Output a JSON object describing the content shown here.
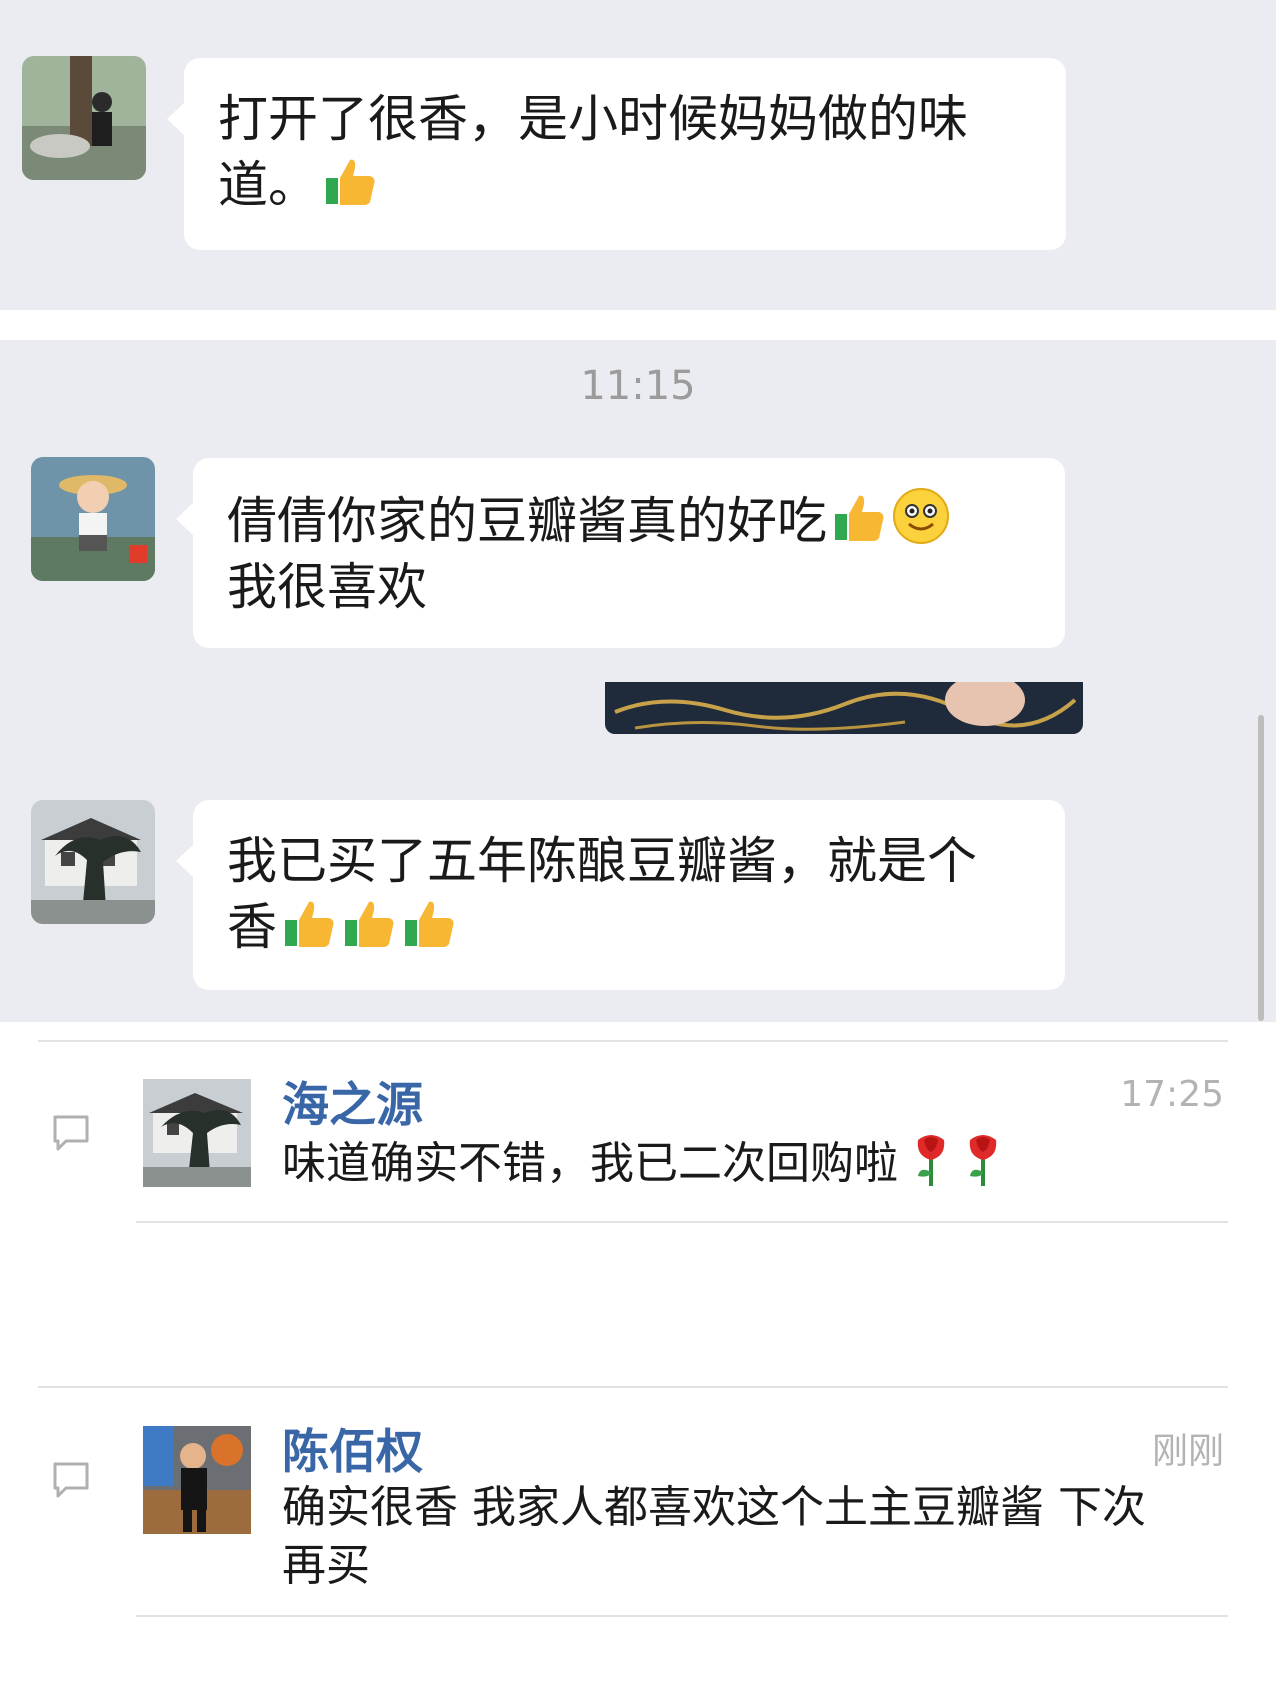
{
  "chat": {
    "messages": [
      {
        "text_line1": "打开了很香，是小时候妈妈做的味",
        "text_line2": "道。",
        "trailing_emoji": [
          "thumbs-up"
        ]
      },
      {
        "text_line1": "倩倩你家的豆瓣酱真的好吃",
        "text_line2": "我很喜欢",
        "trailing_emoji": [
          "thumbs-up",
          "smile"
        ]
      },
      {
        "text_line1": "我已买了五年陈酿豆瓣酱，就是个",
        "text_line2": "香",
        "trailing_emoji": [
          "thumbs-up",
          "thumbs-up",
          "thumbs-up"
        ]
      }
    ],
    "timestamp": "11:15"
  },
  "comments": [
    {
      "name": "海之源",
      "time": "17:25",
      "text": "味道确实不错，我已二次回购啦",
      "emoji": [
        "rose",
        "rose"
      ]
    },
    {
      "name": "陈佰权",
      "time": "刚刚",
      "text_line1": "确实很香 我家人都喜欢这个土主豆瓣酱 下次",
      "text_line2": "再买"
    }
  ],
  "colors": {
    "chat_background": "#ebecf1",
    "bubble": "#ffffff",
    "comment_name": "#3866a6",
    "meta_text": "#b3b3b3"
  }
}
